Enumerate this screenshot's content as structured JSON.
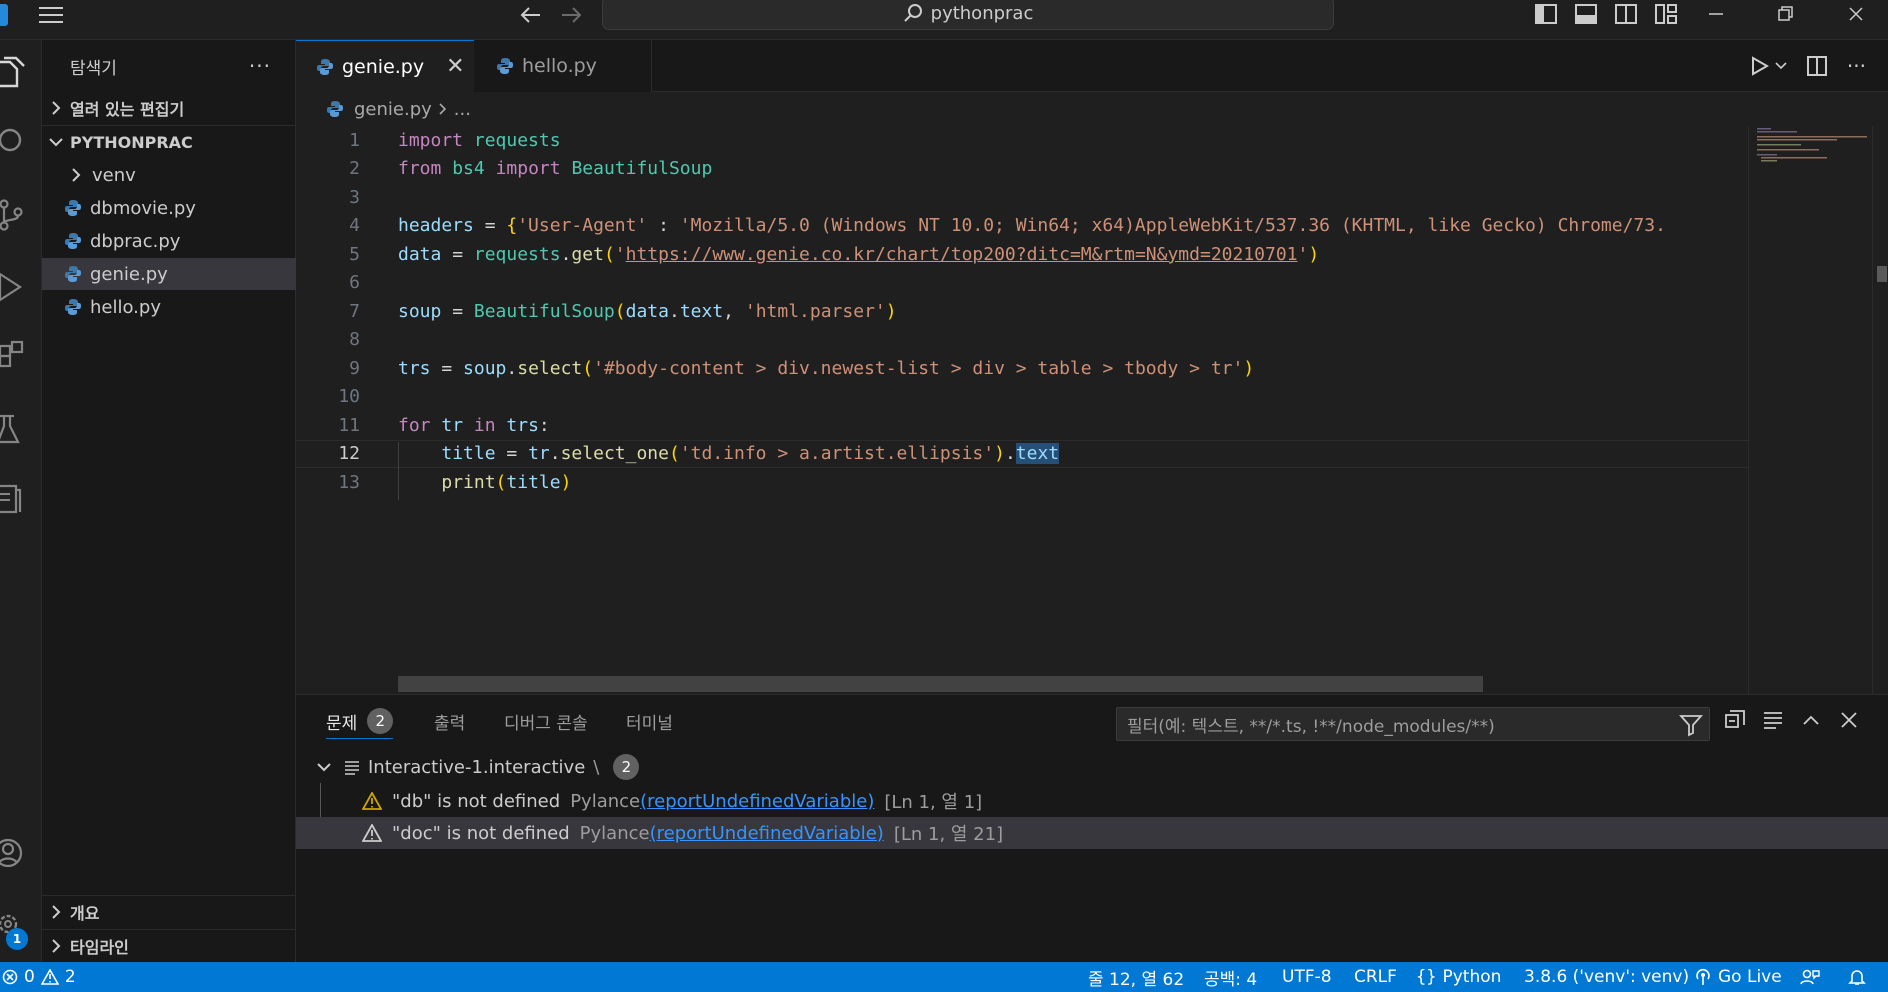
{
  "titlebar": {
    "search_text": "pythonprac"
  },
  "explorer": {
    "title": "탐색기",
    "more": "···",
    "open_editors": "열려 있는 편집기",
    "project": "PYTHONPRAC",
    "items": [
      {
        "label": "venv",
        "type": "folder"
      },
      {
        "label": "dbmovie.py",
        "type": "python"
      },
      {
        "label": "dbprac.py",
        "type": "python"
      },
      {
        "label": "genie.py",
        "type": "python"
      },
      {
        "label": "hello.py",
        "type": "python"
      }
    ],
    "outline": "개요",
    "timeline": "타임라인"
  },
  "tabs": [
    {
      "label": "genie.py",
      "active": true
    },
    {
      "label": "hello.py",
      "active": false
    }
  ],
  "breadcrumb": {
    "file": "genie.py",
    "rest": "..."
  },
  "code": {
    "line_numbers": [
      "1",
      "2",
      "3",
      "4",
      "5",
      "6",
      "7",
      "8",
      "9",
      "10",
      "11",
      "12",
      "13"
    ],
    "current_line": 12,
    "l1_kw": "import",
    "l1_mod": "requests",
    "l2_kw1": "from",
    "l2_mod": "bs4",
    "l2_kw2": "import",
    "l2_cls": "BeautifulSoup",
    "l4_var": "headers",
    "l4_op": " = ",
    "l4_open": "{",
    "l4_key": "'User-Agent'",
    "l4_colon": " : ",
    "l4_val": "'Mozilla/5.0 (Windows NT 10.0; Win64; x64)AppleWebKit/537.36 (KHTML, like Gecko) Chrome/73.",
    "l5_var": "data",
    "l5_op": " = ",
    "l5_mod": "requests",
    "l5_dot": ".",
    "l5_fn": "get",
    "l5_open": "(",
    "l5_q1": "'",
    "l5_url": "https://www.genie.co.kr/chart/top200?ditc=M&rtm=N&ymd=20210701",
    "l5_q2": "'",
    "l5_close": ")",
    "l7_var": "soup",
    "l7_op": " = ",
    "l7_cls": "BeautifulSoup",
    "l7_open": "(",
    "l7_arg1": "data",
    "l7_dot": ".",
    "l7_attr": "text",
    "l7_comma": ", ",
    "l7_str": "'html.parser'",
    "l7_close": ")",
    "l9_var": "trs",
    "l9_op": " = ",
    "l9_obj": "soup",
    "l9_dot": ".",
    "l9_fn": "select",
    "l9_open": "(",
    "l9_str": "'#body-content > div.newest-list > div > table > tbody > tr'",
    "l9_close": ")",
    "l11_kw1": "for",
    "l11_var1": " tr ",
    "l11_kw2": "in",
    "l11_var2": " trs",
    "l11_colon": ":",
    "l12_indent": "    ",
    "l12_var": "title",
    "l12_op": " = ",
    "l12_obj": "tr",
    "l12_dot": ".",
    "l12_fn": "select_one",
    "l12_open": "(",
    "l12_str": "'td.info > a.artist.ellipsis'",
    "l12_close": ")",
    "l12_dot2": ".",
    "l12_attr": "text",
    "l13_indent": "    ",
    "l13_fn": "print",
    "l13_open": "(",
    "l13_arg": "title",
    "l13_close": ")"
  },
  "panel": {
    "tabs": [
      {
        "label": "문제",
        "active": true,
        "count": "2"
      },
      {
        "label": "출력",
        "active": false
      },
      {
        "label": "디버그 콘솔",
        "active": false
      },
      {
        "label": "터미널",
        "active": false
      }
    ],
    "filter_placeholder": "필터(예: 텍스트, **/*.ts, !**/node_modules/**)",
    "group": {
      "file": "Interactive-1.interactive",
      "sep": "\\",
      "count": "2"
    },
    "problems": [
      {
        "message": "\"db\" is not defined",
        "source": "Pylance",
        "code": "(reportUndefinedVariable)",
        "location": "[Ln 1, 열 1]"
      },
      {
        "message": "\"doc\" is not defined",
        "source": "Pylance",
        "code": "(reportUndefinedVariable)",
        "location": "[Ln 1, 열 21]"
      }
    ]
  },
  "statusbar": {
    "errors": "0",
    "warnings": "2",
    "position": "줄 12, 열 62",
    "indent": "공백: 4",
    "encoding": "UTF-8",
    "eol": "CRLF",
    "language": "Python",
    "interpreter": "3.8.6 ('venv': venv)",
    "golive": "Go Live"
  },
  "notifications_badge": "1",
  "colors": {
    "accent": "#0078d4",
    "editor_bg": "#1f1f1f",
    "warning": "#cca700"
  }
}
